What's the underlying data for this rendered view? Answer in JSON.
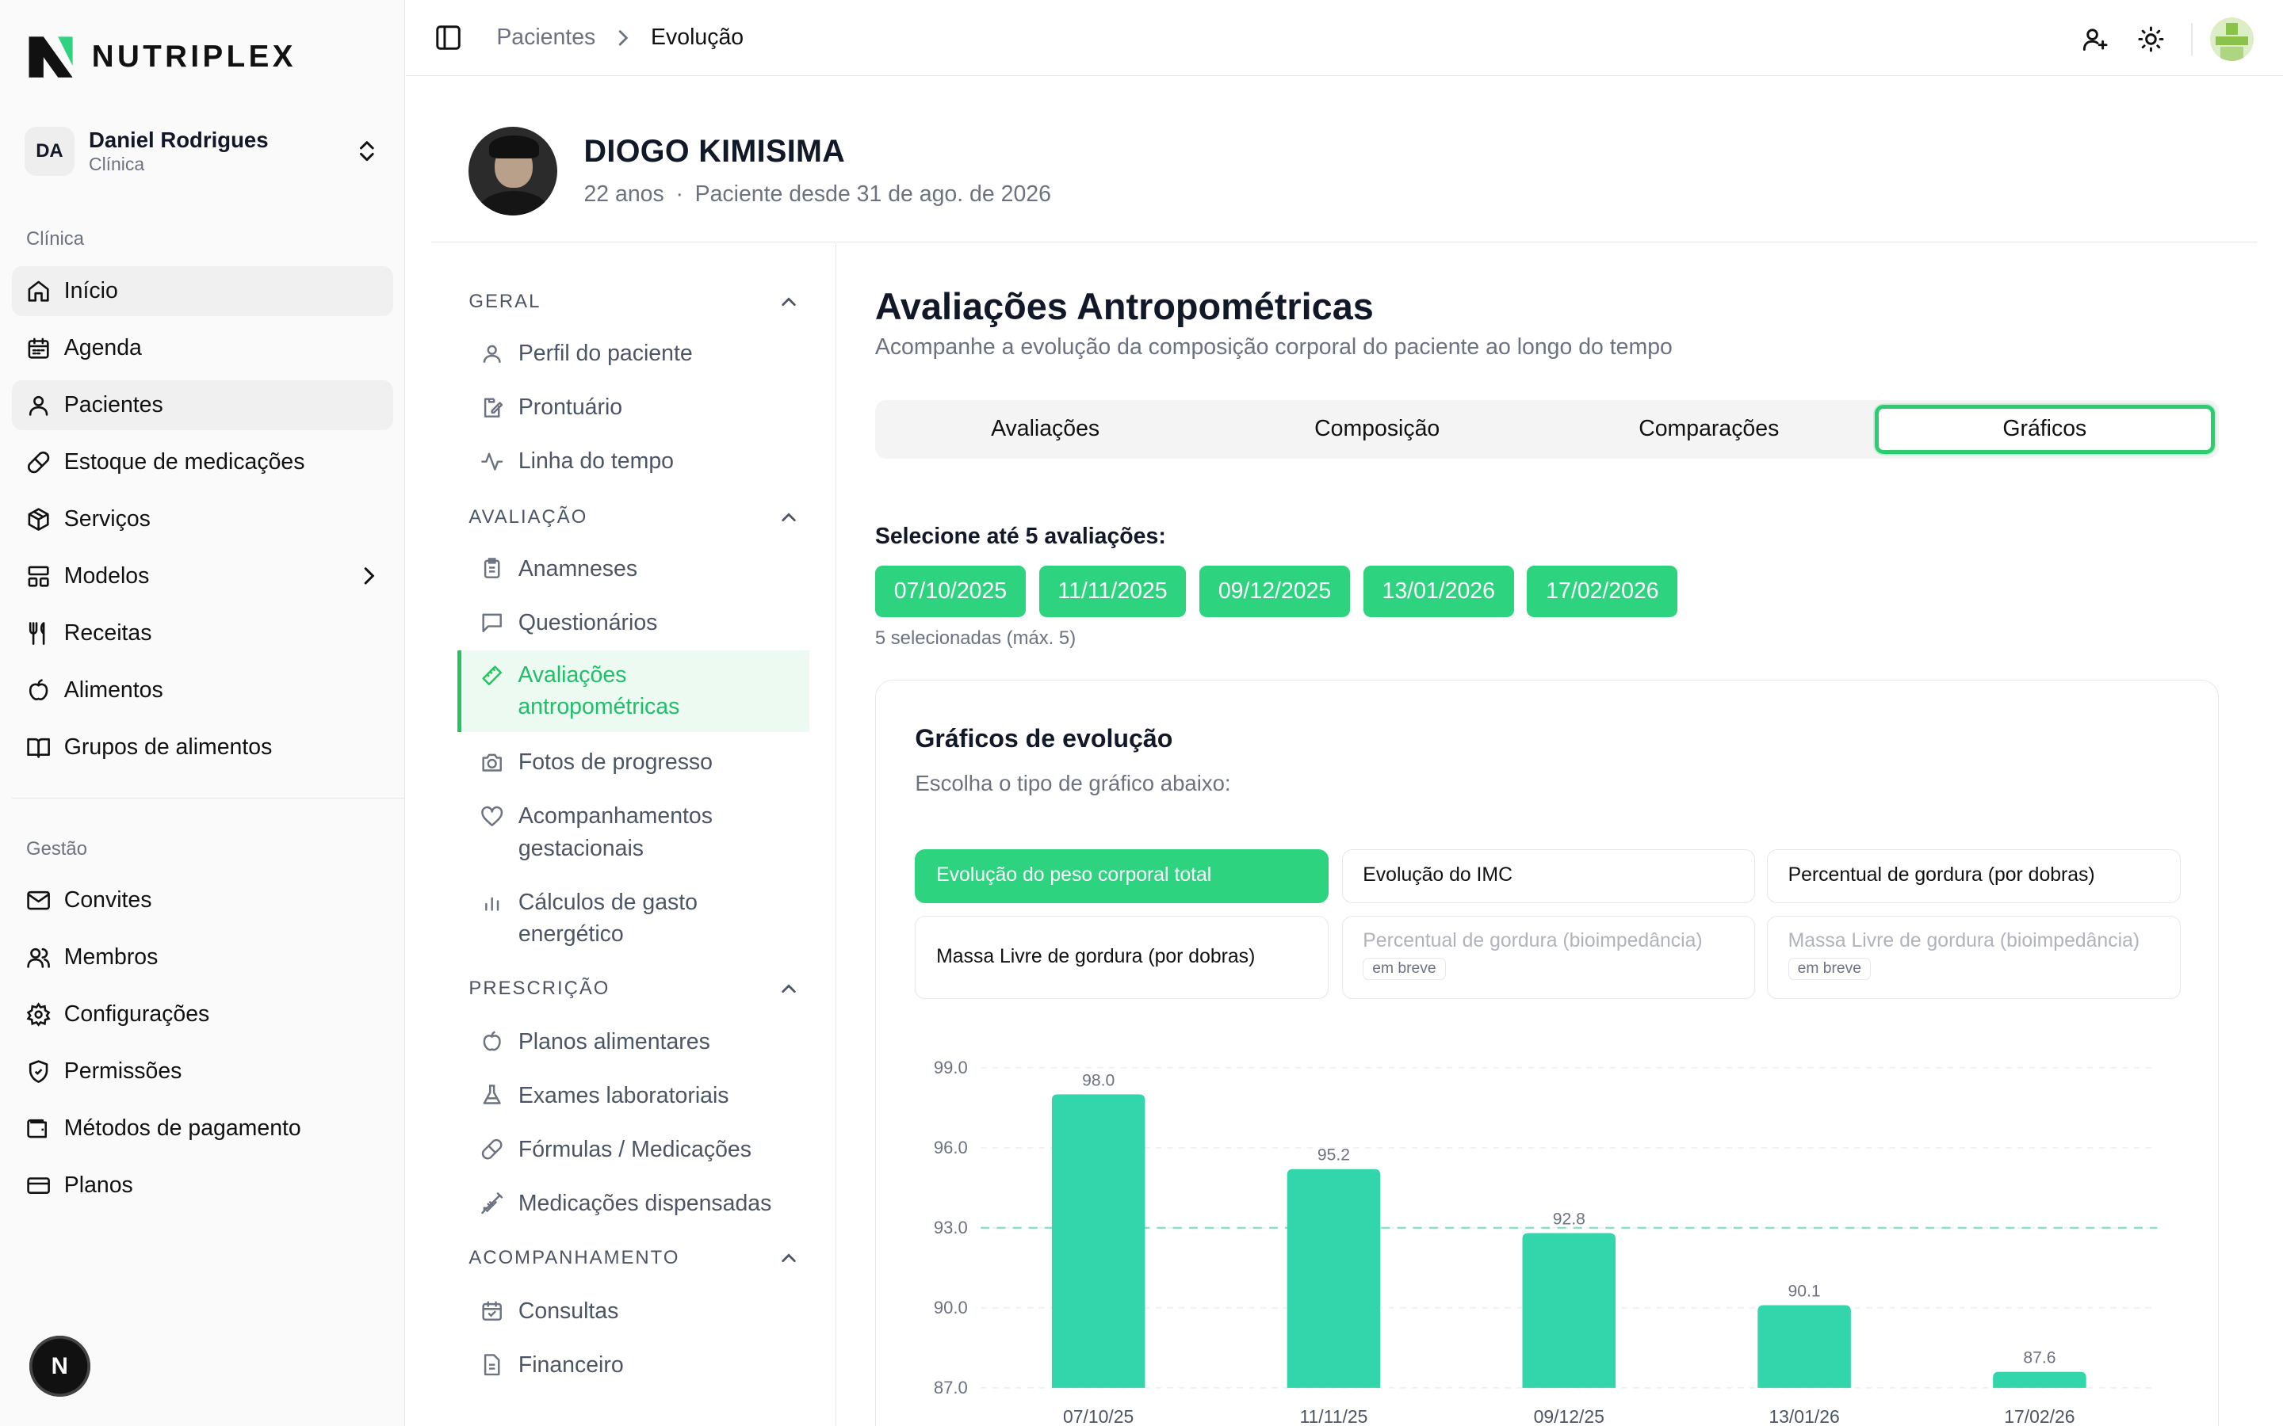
{
  "brand": {
    "name": "NUTRIPLEX"
  },
  "account": {
    "initials": "DA",
    "name": "Daniel Rodrigues",
    "role": "Clínica"
  },
  "sidebar": {
    "section1": "Clínica",
    "items1": [
      {
        "label": "Início",
        "icon": "home-icon",
        "active": true
      },
      {
        "label": "Agenda",
        "icon": "calendar-icon"
      },
      {
        "label": "Pacientes",
        "icon": "user-icon",
        "active": true
      },
      {
        "label": "Estoque de medicações",
        "icon": "pill-icon"
      },
      {
        "label": "Serviços",
        "icon": "package-icon"
      },
      {
        "label": "Modelos",
        "icon": "layout-icon",
        "arrow": true
      },
      {
        "label": "Receitas",
        "icon": "utensils-icon"
      },
      {
        "label": "Alimentos",
        "icon": "apple-icon"
      },
      {
        "label": "Grupos de alimentos",
        "icon": "book-icon"
      }
    ],
    "section2": "Gestão",
    "items2": [
      {
        "label": "Convites",
        "icon": "mail-icon"
      },
      {
        "label": "Membros",
        "icon": "users-icon"
      },
      {
        "label": "Configurações",
        "icon": "settings-icon"
      },
      {
        "label": "Permissões",
        "icon": "shield-icon"
      },
      {
        "label": "Métodos de pagamento",
        "icon": "wallet-icon"
      },
      {
        "label": "Planos",
        "icon": "credit-card-icon"
      }
    ],
    "badge": "N"
  },
  "breadcrumb": {
    "parent": "Pacientes",
    "current": "Evolução"
  },
  "patient": {
    "name": "DIOGO KIMISIMA",
    "age": "22 anos",
    "separator": "·",
    "since": "Paciente desde 31 de ago. de 2026"
  },
  "subnav": {
    "groups": [
      {
        "title": "GERAL",
        "items": [
          "Perfil do paciente",
          "Prontuário",
          "Linha do tempo"
        ]
      },
      {
        "title": "AVALIAÇÃO",
        "items": [
          "Anamneses",
          "Questionários",
          "Avaliações antropométricas",
          "Fotos de progresso",
          "Acompanhamentos gestacionais",
          "Cálculos de gasto energético"
        ]
      },
      {
        "title": "PRESCRIÇÃO",
        "items": [
          "Planos alimentares",
          "Exames laboratoriais",
          "Fórmulas / Medicações",
          "Medicações dispensadas"
        ]
      },
      {
        "title": "ACOMPANHAMENTO",
        "items": [
          "Consultas",
          "Financeiro"
        ]
      }
    ],
    "active": "Avaliações antropométricas"
  },
  "main": {
    "title": "Avaliações Antropométricas",
    "subtitle": "Acompanhe a evolução da composição corporal do paciente ao longo do tempo",
    "tabs": [
      "Avaliações",
      "Composição",
      "Comparações",
      "Gráficos"
    ],
    "active_tab": "Gráficos",
    "select_label": "Selecione até 5 avaliações:",
    "dates": [
      "07/10/2025",
      "11/11/2025",
      "09/12/2025",
      "13/01/2026",
      "17/02/2026"
    ],
    "selected_count": "5 selecionadas (máx. 5)"
  },
  "card": {
    "title": "Gráficos de evolução",
    "subtitle": "Escolha o tipo de gráfico abaixo:",
    "chart_types": [
      {
        "label": "Evolução do peso corporal total",
        "state": "active"
      },
      {
        "label": "Evolução do IMC",
        "state": "normal"
      },
      {
        "label": "Percentual de gordura (por dobras)",
        "state": "normal"
      },
      {
        "label": "Massa Livre de gordura (por dobras)",
        "state": "normal"
      },
      {
        "label": "Percentual de gordura (bioimpedância)",
        "state": "disabled",
        "badge": "em breve"
      },
      {
        "label": "Massa Livre de gordura (bioimpedância)",
        "state": "disabled",
        "badge": "em breve"
      }
    ]
  },
  "colors": {
    "accent": "#2ed37f",
    "bar": "#33d6ab",
    "active_border": "#22c55e"
  },
  "chart_data": {
    "type": "bar",
    "categories": [
      "07/10/25",
      "11/11/25",
      "09/12/25",
      "13/01/26",
      "17/02/26"
    ],
    "values": [
      98.0,
      95.2,
      92.8,
      90.1,
      87.6
    ],
    "yticks": [
      "99.0",
      "96.0",
      "93.0",
      "90.0",
      "87.0"
    ],
    "ylim": [
      87,
      99
    ],
    "reference_line": 93.0,
    "grid": true
  }
}
